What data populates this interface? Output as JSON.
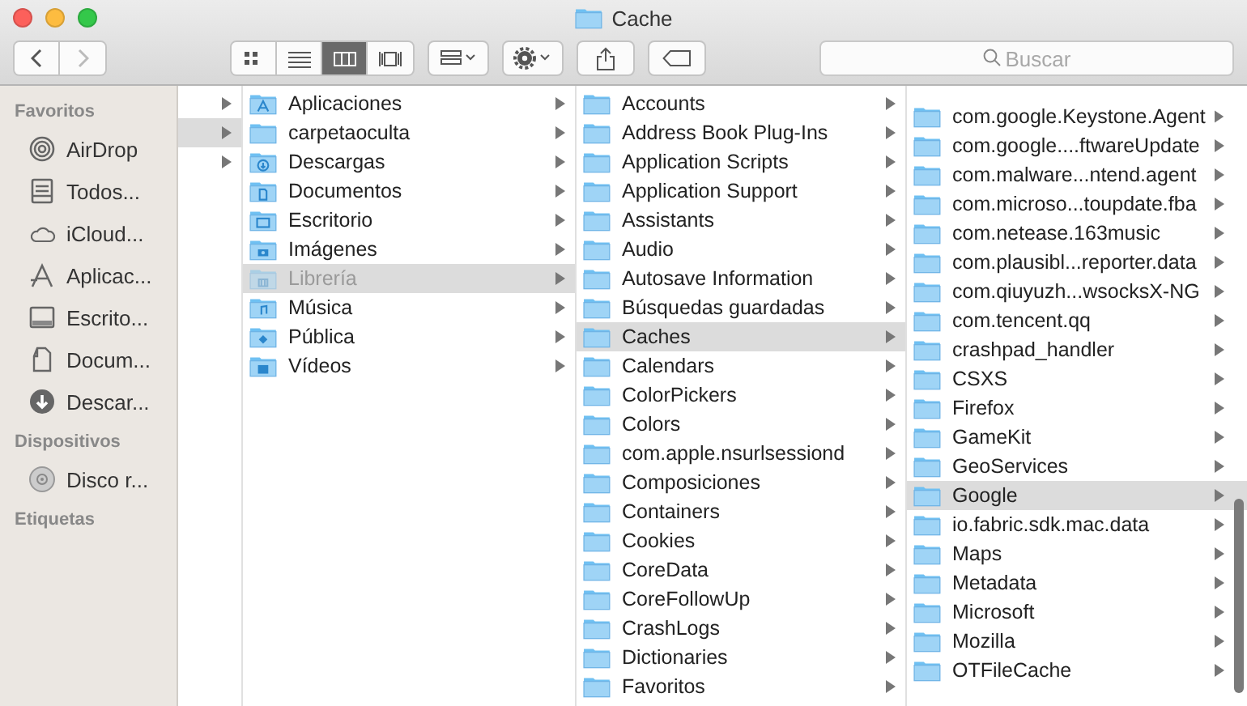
{
  "window": {
    "title": "Cache"
  },
  "toolbar": {
    "view_modes": [
      {
        "kind": "icons",
        "selected": false
      },
      {
        "kind": "list",
        "selected": false
      },
      {
        "kind": "columns",
        "selected": true
      },
      {
        "kind": "gallery",
        "selected": false
      }
    ],
    "search": {
      "placeholder": "Buscar"
    }
  },
  "sidebar": {
    "sections": [
      {
        "title": "Favoritos",
        "items": [
          {
            "label": "AirDrop",
            "kind": "airdrop"
          },
          {
            "label": "Todos...",
            "kind": "files"
          },
          {
            "label": "iCloud...",
            "kind": "cloud"
          },
          {
            "label": "Aplicac...",
            "kind": "apps"
          },
          {
            "label": "Escrito...",
            "kind": "desktop"
          },
          {
            "label": "Docum...",
            "kind": "documents"
          },
          {
            "label": "Descar...",
            "kind": "downloads"
          }
        ]
      },
      {
        "title": "Dispositivos",
        "items": [
          {
            "label": "Disco r...",
            "kind": "disc"
          }
        ]
      },
      {
        "title": "Etiquetas"
      }
    ]
  },
  "columns": [
    {
      "rows": [
        {
          "selected": false
        },
        {
          "selected": true
        },
        {
          "selected": false
        }
      ]
    },
    {
      "rows": [
        {
          "label": "Aplicaciones",
          "kind": "apps",
          "selected": false,
          "dimmed": false
        },
        {
          "label": "carpetaoculta",
          "kind": "plain",
          "selected": false,
          "dimmed": false
        },
        {
          "label": "Descargas",
          "kind": "downloads",
          "selected": false,
          "dimmed": false
        },
        {
          "label": "Documentos",
          "kind": "documents",
          "selected": false,
          "dimmed": false
        },
        {
          "label": "Escritorio",
          "kind": "desktop",
          "selected": false,
          "dimmed": false
        },
        {
          "label": "Imágenes",
          "kind": "pictures",
          "selected": false,
          "dimmed": false
        },
        {
          "label": "Librería",
          "kind": "library",
          "selected": true,
          "dimmed": true
        },
        {
          "label": "Música",
          "kind": "music",
          "selected": false,
          "dimmed": false
        },
        {
          "label": "Pública",
          "kind": "public",
          "selected": false,
          "dimmed": false
        },
        {
          "label": "Vídeos",
          "kind": "movies",
          "selected": false,
          "dimmed": false
        }
      ]
    },
    {
      "rows": [
        {
          "label": "Accounts",
          "selected": false
        },
        {
          "label": "Address Book Plug-Ins",
          "selected": false
        },
        {
          "label": "Application Scripts",
          "selected": false
        },
        {
          "label": "Application Support",
          "selected": false
        },
        {
          "label": "Assistants",
          "selected": false
        },
        {
          "label": "Audio",
          "selected": false
        },
        {
          "label": "Autosave Information",
          "selected": false
        },
        {
          "label": "Búsquedas guardadas",
          "selected": false
        },
        {
          "label": "Caches",
          "selected": true
        },
        {
          "label": "Calendars",
          "selected": false
        },
        {
          "label": "ColorPickers",
          "selected": false
        },
        {
          "label": "Colors",
          "selected": false
        },
        {
          "label": "com.apple.nsurlsessiond",
          "selected": false
        },
        {
          "label": "Composiciones",
          "selected": false
        },
        {
          "label": "Containers",
          "selected": false
        },
        {
          "label": "Cookies",
          "selected": false
        },
        {
          "label": "CoreData",
          "selected": false
        },
        {
          "label": "CoreFollowUp",
          "selected": false
        },
        {
          "label": "CrashLogs",
          "selected": false
        },
        {
          "label": "Dictionaries",
          "selected": false
        },
        {
          "label": "Favoritos",
          "selected": false
        }
      ]
    },
    {
      "rows": [
        {
          "label": "com.google.Keystone.Agent",
          "selected": false
        },
        {
          "label": "com.google....ftwareUpdate",
          "selected": false
        },
        {
          "label": "com.malware...ntend.agent",
          "selected": false
        },
        {
          "label": "com.microso...toupdate.fba",
          "selected": false
        },
        {
          "label": "com.netease.163music",
          "selected": false
        },
        {
          "label": "com.plausibl...reporter.data",
          "selected": false
        },
        {
          "label": "com.qiuyuzh...wsocksX-NG",
          "selected": false
        },
        {
          "label": "com.tencent.qq",
          "selected": false
        },
        {
          "label": "crashpad_handler",
          "selected": false
        },
        {
          "label": "CSXS",
          "selected": false
        },
        {
          "label": "Firefox",
          "selected": false
        },
        {
          "label": "GameKit",
          "selected": false
        },
        {
          "label": "GeoServices",
          "selected": false
        },
        {
          "label": "Google",
          "selected": true
        },
        {
          "label": "io.fabric.sdk.mac.data",
          "selected": false
        },
        {
          "label": "Maps",
          "selected": false
        },
        {
          "label": "Metadata",
          "selected": false
        },
        {
          "label": "Microsoft",
          "selected": false
        },
        {
          "label": "Mozilla",
          "selected": false
        },
        {
          "label": "OTFileCache",
          "selected": false
        }
      ]
    }
  ]
}
